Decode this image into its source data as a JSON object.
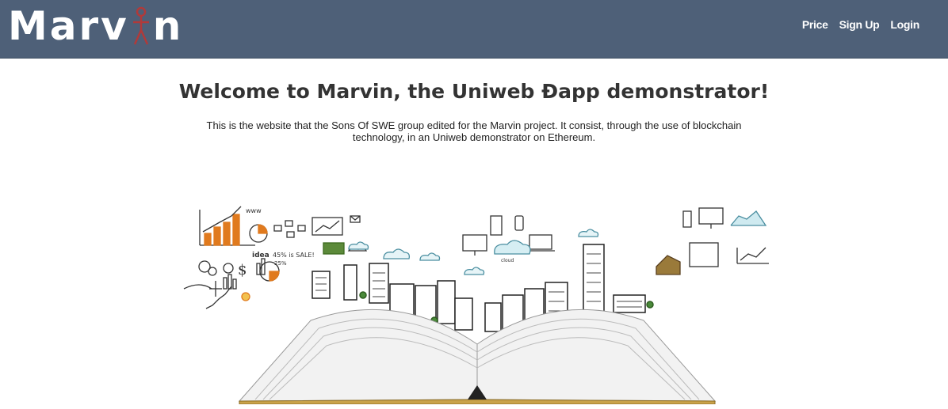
{
  "header": {
    "brand": {
      "prefix": "Marv",
      "suffix": "n",
      "figure_icon": "stick-figure-icon",
      "figure_color": "#b03a3a"
    },
    "nav": [
      {
        "label": "Price"
      },
      {
        "label": "Sign Up"
      },
      {
        "label": "Login"
      }
    ],
    "background": "#4e6078"
  },
  "main": {
    "title": "Welcome to Marvin, the Uniweb Đapp demonstrator!",
    "lead": "This is the website that the Sons Of SWE group edited for the Marvin project. It consist, through the use of blockchain technology, in an Uniweb demonstrator on Ethereum.",
    "hero": {
      "icon": "open-book-city-illustration",
      "sketch_text": {
        "www": "www",
        "idea": "idea",
        "sale": "45% is SALE!",
        "percent": "25%",
        "cloud": "cloud"
      },
      "accent": "#e07a1e"
    }
  }
}
